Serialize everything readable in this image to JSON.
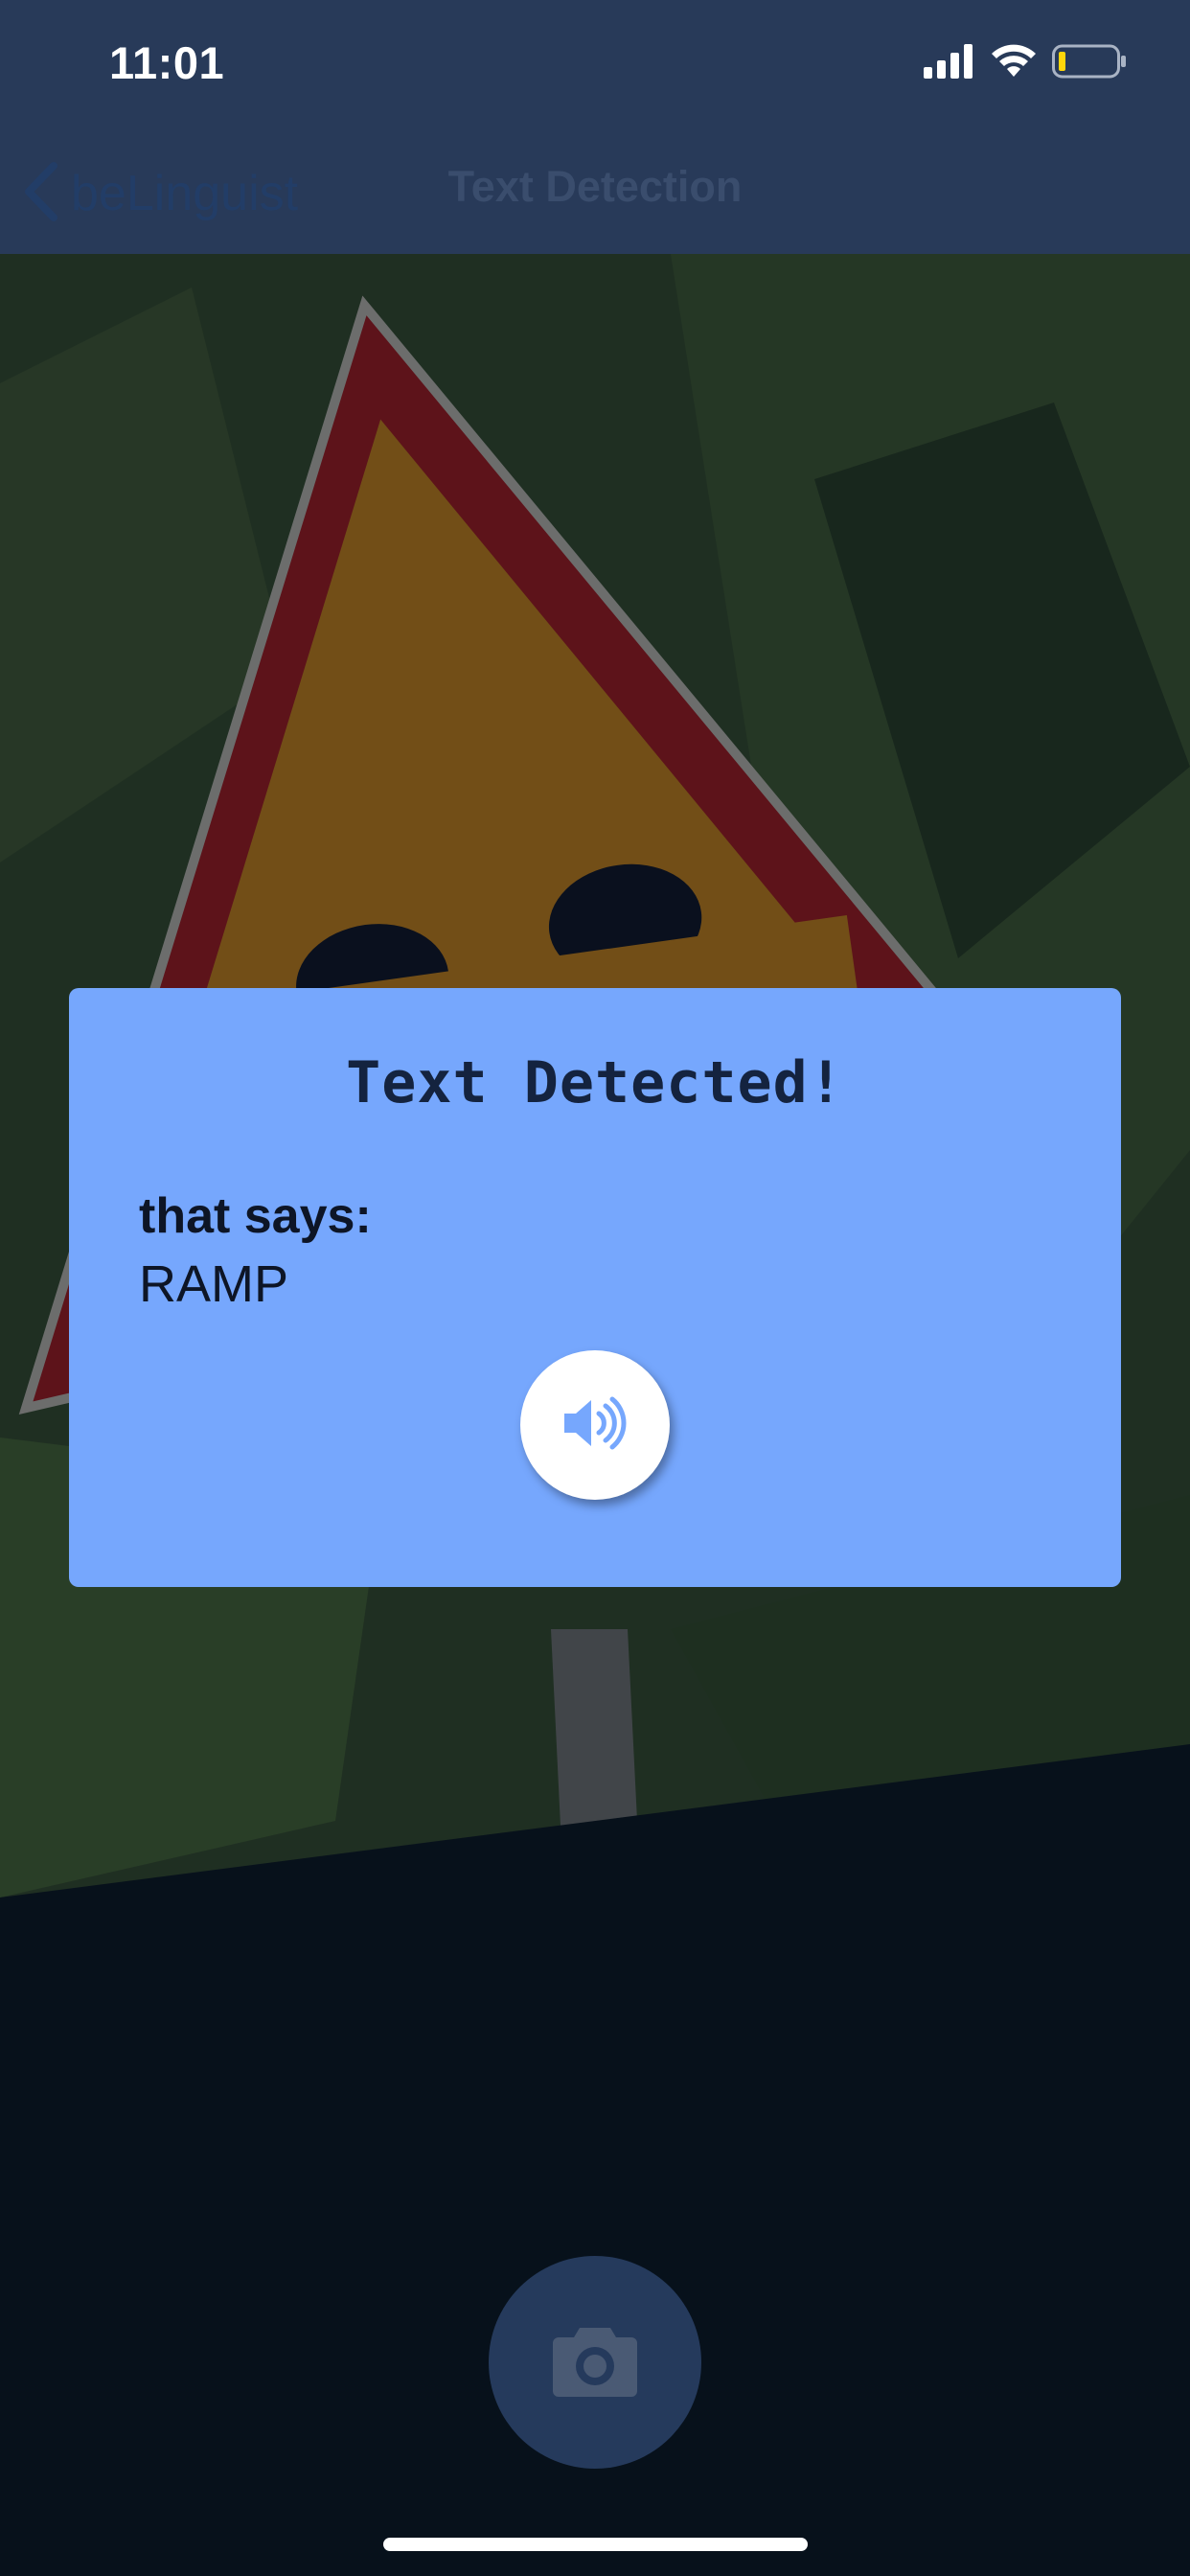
{
  "status_bar": {
    "time": "11:01",
    "icons": [
      "signal-icon",
      "wifi-icon",
      "battery-icon"
    ]
  },
  "nav": {
    "back_label": "beLinguist",
    "title": "Text Detection"
  },
  "modal": {
    "title": "Text Detected!",
    "label": "that says:",
    "detected_text": "RAMP",
    "speak_icon": "speaker-icon"
  },
  "camera": {
    "icon": "camera-icon"
  },
  "colors": {
    "nav_background": "#283a59",
    "modal_background": "#76a7fd",
    "camera_button": "#253a5c",
    "sign_red": "#c81c1f",
    "sign_orange": "#f59d1a"
  }
}
